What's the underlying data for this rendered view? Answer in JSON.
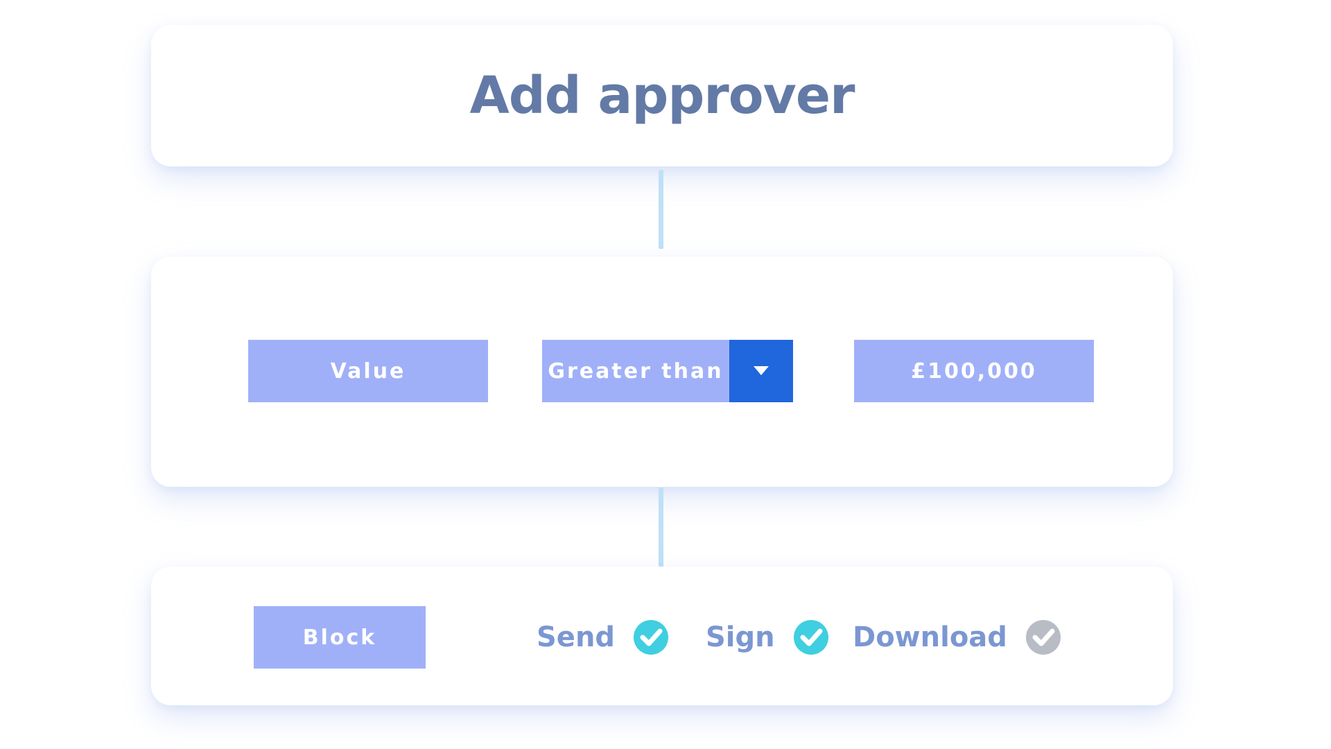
{
  "title": "Add approver",
  "condition": {
    "field": "Value",
    "operator": "Greater than",
    "amount": "£100,000"
  },
  "action": {
    "block_label": "Block",
    "permissions": [
      {
        "label": "Send",
        "enabled": true,
        "color": "#3fcfe0"
      },
      {
        "label": "Sign",
        "enabled": true,
        "color": "#3fcfe0"
      },
      {
        "label": "Download",
        "enabled": false,
        "color": "#b8bcc4"
      }
    ]
  },
  "colors": {
    "pill": "#a0b0f8",
    "dropdown_accent": "#2066dd",
    "title_text": "#637aa6",
    "permission_text": "#7b97d2",
    "connector": "#bfe0f7"
  },
  "icons": {
    "dropdown": "chevron-down-icon",
    "check_on": "check-circle-icon",
    "check_off": "check-circle-disabled-icon"
  }
}
